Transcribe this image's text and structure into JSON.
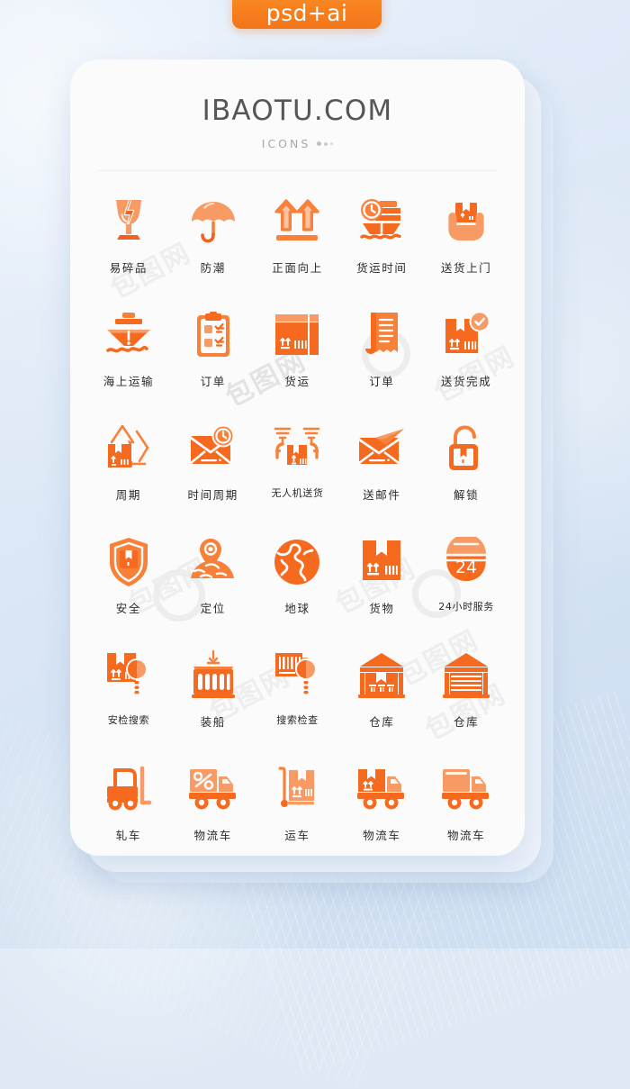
{
  "badge": {
    "label": "psd+ai",
    "color": "#f7801d"
  },
  "header": {
    "title": "IBAOTU.COM",
    "subtitle": "ICONS",
    "title_color": "#565656",
    "subtitle_color": "#a9a9a9"
  },
  "watermark": {
    "text": "包图网"
  },
  "palette": {
    "orange_dark": "#f1621d",
    "orange": "#f56a1e",
    "orange_mid": "#f8813a",
    "orange_light": "#f79a63",
    "orange_pale": "#fbb58a",
    "label": "#2a2a2a",
    "card": "#fbfbfb",
    "background": "#dde8f6"
  },
  "grid": {
    "columns": 5,
    "rows": 6,
    "icons": [
      {
        "label": "易碎品",
        "icon": "fragile-glass-icon"
      },
      {
        "label": "防潮",
        "icon": "umbrella-icon"
      },
      {
        "label": "正面向上",
        "icon": "this-side-up-arrows-icon"
      },
      {
        "label": "货运时间",
        "icon": "ship-clock-icon"
      },
      {
        "label": "送货上门",
        "icon": "hands-holding-box-icon"
      },
      {
        "label": "海上运输",
        "icon": "cargo-ship-icon"
      },
      {
        "label": "订单",
        "icon": "clipboard-checklist-icon"
      },
      {
        "label": "货运",
        "icon": "cardboard-box-icon"
      },
      {
        "label": "订单",
        "icon": "receipt-icon"
      },
      {
        "label": "送货完成",
        "icon": "box-checkmark-icon"
      },
      {
        "label": "周期",
        "icon": "recycle-box-icon"
      },
      {
        "label": "时间周期",
        "icon": "envelope-clock-icon"
      },
      {
        "label": "无人机送货",
        "icon": "drone-delivery-icon"
      },
      {
        "label": "送邮件",
        "icon": "send-mail-icon"
      },
      {
        "label": "解锁",
        "icon": "unlock-box-icon"
      },
      {
        "label": "安全",
        "icon": "shield-box-icon"
      },
      {
        "label": "定位",
        "icon": "location-pin-globe-icon"
      },
      {
        "label": "地球",
        "icon": "globe-icon"
      },
      {
        "label": "货物",
        "icon": "parcel-box-icon"
      },
      {
        "label": "24小时服务",
        "icon": "24h-service-icon"
      },
      {
        "label": "安检搜索",
        "icon": "box-magnifier-icon"
      },
      {
        "label": "装船",
        "icon": "container-crane-icon"
      },
      {
        "label": "搜索检查",
        "icon": "barcode-magnifier-icon"
      },
      {
        "label": "仓库",
        "icon": "warehouse-boxes-icon"
      },
      {
        "label": "仓库",
        "icon": "warehouse-shutter-icon"
      },
      {
        "label": "轧车",
        "icon": "forklift-icon"
      },
      {
        "label": "物流车",
        "icon": "delivery-truck-percent-icon"
      },
      {
        "label": "运车",
        "icon": "hand-trolley-icon"
      },
      {
        "label": "物流车",
        "icon": "delivery-truck-box-icon"
      },
      {
        "label": "物流车",
        "icon": "delivery-truck-plain-icon"
      }
    ]
  }
}
